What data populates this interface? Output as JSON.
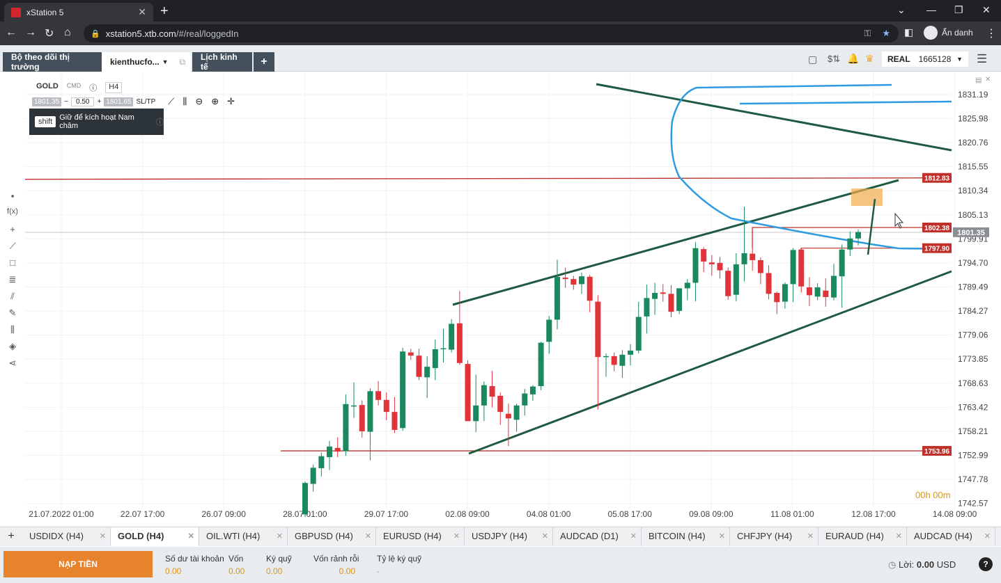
{
  "browser": {
    "tab_title": "xStation 5",
    "url_host": "xstation5.xtb.com",
    "url_path": "/#/real/loggedIn",
    "profile_label": "Ẩn danh"
  },
  "app": {
    "tabs": [
      "Bộ theo dõi thị trường",
      "kienthucfo...",
      "Lịch kinh tế"
    ],
    "account_type": "REAL",
    "account_id": "1665128"
  },
  "chart": {
    "symbol": "GOLD",
    "symbol_sub": "CMD",
    "timeframe": "H4",
    "sell_price": "1801.35",
    "volume": "0.50",
    "buy_price": "1801.65",
    "sl_tp": "SL/TP",
    "tooltip_key": "shift",
    "tooltip_text": "Giữ để kích hoạt Nam châm",
    "timer": "00h 00m",
    "colors": {
      "up": "#1a8a5e",
      "down": "#e0343a",
      "trend": "#1e5a40",
      "level": "#c0302b",
      "curve": "#2f9be0",
      "zone": "#f4a94b"
    }
  },
  "chart_data": {
    "type": "candlestick",
    "instrument": "GOLD (H4)",
    "y_axis": [
      1831.19,
      1825.98,
      1820.76,
      1815.55,
      1810.34,
      1805.13,
      1799.91,
      1794.7,
      1789.49,
      1784.27,
      1779.06,
      1773.85,
      1768.63,
      1763.42,
      1758.21,
      1752.99,
      1747.78,
      1742.57
    ],
    "ylim": [
      1741.0,
      1834.5
    ],
    "x_labels": [
      "21.07.2022 01:00",
      "22.07 17:00",
      "26.07 09:00",
      "28.07 01:00",
      "29.07 17:00",
      "02.08 09:00",
      "04.08 01:00",
      "05.08 17:00",
      "09.08 09:00",
      "11.08 01:00",
      "12.08 17:00",
      "14.08 09:00"
    ],
    "price_labels": [
      {
        "text": "1812.83",
        "value": 1812.83,
        "type": "level"
      },
      {
        "text": "1802.38",
        "value": 1802.38,
        "type": "level"
      },
      {
        "text": "1801.35",
        "value": 1801.35,
        "type": "current"
      },
      {
        "text": "1797.90",
        "value": 1797.9,
        "type": "level"
      },
      {
        "text": "1753.96",
        "value": 1753.96,
        "type": "level"
      }
    ],
    "ohlc": [
      [
        1740.2,
        1747.3,
        1739.6,
        1747.0
      ],
      [
        1746.8,
        1751.0,
        1745.1,
        1750.3
      ],
      [
        1750.2,
        1753.6,
        1748.4,
        1752.8
      ],
      [
        1752.6,
        1756.1,
        1749.8,
        1754.9
      ],
      [
        1754.6,
        1756.9,
        1752.6,
        1753.8
      ],
      [
        1753.9,
        1766.2,
        1752.9,
        1764.1
      ],
      [
        1763.8,
        1768.8,
        1761.1,
        1763.8
      ],
      [
        1763.9,
        1764.9,
        1756.8,
        1758.2
      ],
      [
        1758.1,
        1767.5,
        1751.9,
        1766.9
      ],
      [
        1766.9,
        1769.1,
        1763.8,
        1765.0
      ],
      [
        1765.0,
        1766.6,
        1760.6,
        1762.4
      ],
      [
        1762.4,
        1765.6,
        1757.8,
        1758.5
      ],
      [
        1758.9,
        1776.3,
        1758.3,
        1775.5
      ],
      [
        1775.3,
        1776.1,
        1773.7,
        1774.6
      ],
      [
        1774.6,
        1776.1,
        1769.3,
        1770.0
      ],
      [
        1769.9,
        1774.5,
        1765.4,
        1772.2
      ],
      [
        1771.9,
        1778.1,
        1769.3,
        1776.0
      ],
      [
        1776.0,
        1780.4,
        1773.1,
        1776.2
      ],
      [
        1775.9,
        1782.5,
        1775.3,
        1781.5
      ],
      [
        1781.6,
        1788.6,
        1772.6,
        1773.0
      ],
      [
        1772.8,
        1773.6,
        1763.6,
        1760.4
      ],
      [
        1760.4,
        1770.5,
        1758.0,
        1763.8
      ],
      [
        1763.8,
        1769.0,
        1760.4,
        1768.2
      ],
      [
        1768.0,
        1771.3,
        1763.4,
        1765.7
      ],
      [
        1765.9,
        1766.6,
        1759.6,
        1762.4
      ],
      [
        1762.0,
        1764.2,
        1755.0,
        1761.0
      ],
      [
        1760.7,
        1764.2,
        1758.1,
        1763.8
      ],
      [
        1763.8,
        1767.4,
        1761.6,
        1766.4
      ],
      [
        1766.2,
        1768.2,
        1764.8,
        1767.9
      ],
      [
        1768.0,
        1777.6,
        1767.1,
        1777.4
      ],
      [
        1777.6,
        1783.2,
        1775.0,
        1782.4
      ],
      [
        1782.4,
        1795.4,
        1780.3,
        1791.7
      ],
      [
        1791.5,
        1793.7,
        1789.3,
        1791.2
      ],
      [
        1791.2,
        1791.9,
        1788.9,
        1790.0
      ],
      [
        1790.1,
        1792.6,
        1788.0,
        1791.8
      ],
      [
        1791.7,
        1792.1,
        1784.0,
        1786.5
      ],
      [
        1786.3,
        1787.7,
        1762.9,
        1774.3
      ],
      [
        1774.3,
        1775.1,
        1770.0,
        1774.5
      ],
      [
        1774.5,
        1775.3,
        1771.2,
        1772.6
      ],
      [
        1772.4,
        1775.8,
        1769.8,
        1774.8
      ],
      [
        1774.8,
        1777.1,
        1772.5,
        1775.7
      ],
      [
        1775.7,
        1786.3,
        1775.1,
        1783.0
      ],
      [
        1783.1,
        1790.0,
        1779.4,
        1787.1
      ],
      [
        1786.9,
        1790.4,
        1783.4,
        1788.2
      ],
      [
        1788.3,
        1790.1,
        1786.3,
        1788.0
      ],
      [
        1788.0,
        1789.9,
        1782.9,
        1784.1
      ],
      [
        1784.3,
        1789.2,
        1783.6,
        1789.2
      ],
      [
        1789.2,
        1791.2,
        1786.6,
        1790.4
      ],
      [
        1790.4,
        1799.2,
        1786.4,
        1797.9
      ],
      [
        1797.7,
        1798.1,
        1792.7,
        1795.0
      ],
      [
        1794.8,
        1796.4,
        1791.9,
        1794.4
      ],
      [
        1794.7,
        1796.0,
        1791.3,
        1793.1
      ],
      [
        1793.0,
        1793.7,
        1786.7,
        1787.5
      ],
      [
        1787.8,
        1796.8,
        1786.4,
        1794.4
      ],
      [
        1794.4,
        1806.9,
        1790.7,
        1796.8
      ],
      [
        1796.7,
        1802.4,
        1793.0,
        1795.3
      ],
      [
        1795.3,
        1795.9,
        1790.1,
        1792.5
      ],
      [
        1792.5,
        1794.2,
        1786.8,
        1788.0
      ],
      [
        1788.2,
        1788.5,
        1783.6,
        1786.2
      ],
      [
        1786.3,
        1790.5,
        1784.8,
        1790.1
      ],
      [
        1790.1,
        1797.9,
        1786.2,
        1797.5
      ],
      [
        1797.6,
        1797.7,
        1788.3,
        1789.6
      ],
      [
        1789.4,
        1791.6,
        1785.3,
        1787.7
      ],
      [
        1787.4,
        1790.3,
        1786.6,
        1789.4
      ],
      [
        1788.7,
        1791.4,
        1785.2,
        1787.3
      ],
      [
        1787.2,
        1794.5,
        1786.6,
        1791.9
      ],
      [
        1791.8,
        1798.7,
        1785.0,
        1797.6
      ],
      [
        1797.6,
        1801.5,
        1796.2,
        1800.0
      ],
      [
        1800.0,
        1802.0,
        1798.5,
        1801.4
      ]
    ]
  },
  "instruments": [
    {
      "label": "USDIDX (H4)",
      "active": false
    },
    {
      "label": "GOLD (H4)",
      "active": true
    },
    {
      "label": "OIL.WTI (H4)",
      "active": false
    },
    {
      "label": "GBPUSD (H4)",
      "active": false
    },
    {
      "label": "EURUSD (H4)",
      "active": false
    },
    {
      "label": "USDJPY (H4)",
      "active": false
    },
    {
      "label": "AUDCAD (D1)",
      "active": false
    },
    {
      "label": "BITCOIN (H4)",
      "active": false
    },
    {
      "label": "CHFJPY (H4)",
      "active": false
    },
    {
      "label": "EURAUD (H4)",
      "active": false
    },
    {
      "label": "AUDCAD (H4)",
      "active": false
    }
  ],
  "footer": {
    "deposit": "NẠP TIỀN",
    "stats": [
      {
        "label": "Số dư tài khoản",
        "value": "0.00"
      },
      {
        "label": "Vốn",
        "value": "0.00"
      },
      {
        "label": "Ký quỹ",
        "value": "0.00"
      },
      {
        "label": "Vốn rảnh rỗi",
        "value": "0.00"
      },
      {
        "label": "Tỷ lệ ký quỹ",
        "value": "-"
      }
    ],
    "profit_label": "Lời:",
    "profit_value": "0.00",
    "profit_currency": "USD"
  }
}
